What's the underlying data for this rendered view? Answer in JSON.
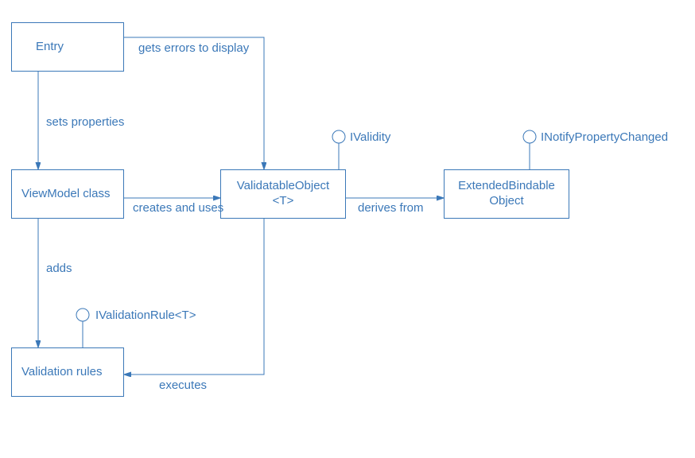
{
  "boxes": {
    "entry": "Entry",
    "viewmodel": "ViewModel class",
    "validatable": "ValidatableObject\n<T>",
    "extended": "ExtendedBindable\nObject",
    "rules": "Validation rules"
  },
  "edges": {
    "getsErrors": "gets errors to display",
    "setsProperties": "sets properties",
    "createsUses": "creates and uses",
    "derivesFrom": "derives from",
    "adds": "adds",
    "executes": "executes"
  },
  "interfaces": {
    "ivalidity": "IValidity",
    "inotify": "INotifyPropertyChanged",
    "ivalidationrule": "IValidationRule<T>"
  }
}
